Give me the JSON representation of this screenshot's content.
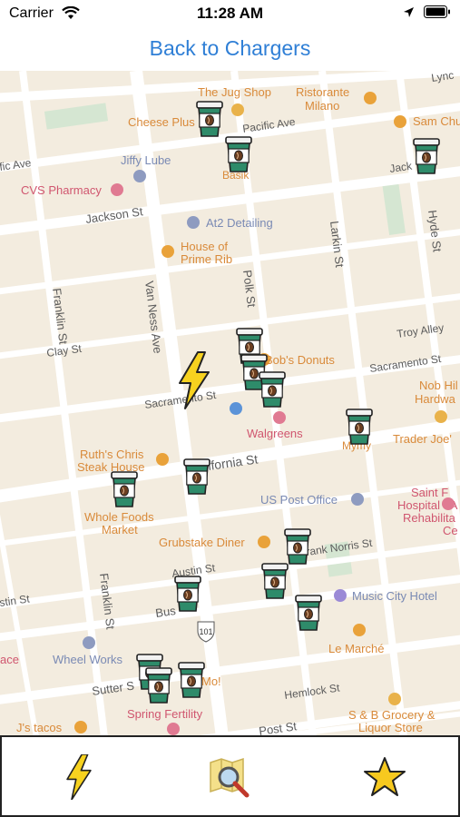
{
  "status_bar": {
    "carrier": "Carrier",
    "time": "11:28 AM"
  },
  "nav": {
    "back_label": "Back to Chargers"
  },
  "map": {
    "streets": {
      "franklin_1": "Franklin St",
      "franklin_2": "Franklin St",
      "van_ness": "Van Ness Ave",
      "polk": "Polk St",
      "larkin": "Larkin St",
      "hyde": "Hyde St",
      "jackson": "Jackson St",
      "pacific": "Pacific Ave",
      "pacific_left": "fic Ave",
      "jack_right": "Jack",
      "clay": "Clay St",
      "sacramento": "Sacramento St",
      "sacramento_right": "Sacramento St",
      "california": "ifornia St",
      "austin": "Austin St",
      "austin_left": "stin St",
      "bush": "Bus",
      "sutter": "Sutter S",
      "frank_norris": "rank Norris St",
      "hemlock": "Hemlock St",
      "post": "Post St",
      "troy_alley": "Troy Alley",
      "lync": "Lync",
      "route_101": "101"
    },
    "places": {
      "jug_shop": "The Jug Shop",
      "ristorante_1": "Ristorante",
      "ristorante_2": "Milano",
      "sam_chu": "Sam Chu",
      "cheese_plus": "Cheese Plus",
      "jiffy_lube": "Jiffy Lube",
      "basik": "Basik",
      "cvs": "CVS Pharmacy",
      "at2": "At2 Detailing",
      "house_prime_1": "House of",
      "house_prime_2": "Prime Rib",
      "bobs_donuts": "Bob's Donuts",
      "walgreens": "Walgreens",
      "nob_hill_1": "Nob Hil",
      "nob_hill_2": "Hardwa",
      "mymy": "Mymy",
      "trader_joes": "Trader Joe'",
      "ruths_1": "Ruth's Chris",
      "ruths_2": "Steak House",
      "whole_foods_1": "Whole Foods",
      "whole_foods_2": "Market",
      "us_post": "US Post Office",
      "saint_1": "Saint F",
      "saint_2": "Hospital - A",
      "saint_3": "Rehabilita",
      "saint_4": "Ce",
      "grubstake": "Grubstake Diner",
      "music_city": "Music City Hotel",
      "le_marche": "Le Marché",
      "wheel_works": "Wheel Works",
      "spring_fertility": "Spring Fertility",
      "mo": "Mo!",
      "sb_grocery_1": "S & B Grocery &",
      "sb_grocery_2": "Liquor Store",
      "js_tacos": "J's tacos",
      "ace": "ace"
    },
    "colors": {
      "land": "#f3ecdf",
      "road": "#ffffff",
      "road_edge": "#e3dccd",
      "park": "#d5e6d2",
      "place_orange": "#d98a3a",
      "place_blue": "#7a8ab4",
      "place_pink": "#d0566f",
      "street_text": "#5b5b5b",
      "cup_body": "#2e8b6a",
      "cup_lid": "#f2f2f2",
      "bolt": "#f7d21f"
    }
  },
  "tabbar": {
    "items": [
      {
        "name": "chargers",
        "icon": "lightning-bolt-icon"
      },
      {
        "name": "search",
        "icon": "map-search-icon"
      },
      {
        "name": "favorites",
        "icon": "star-icon"
      }
    ]
  }
}
